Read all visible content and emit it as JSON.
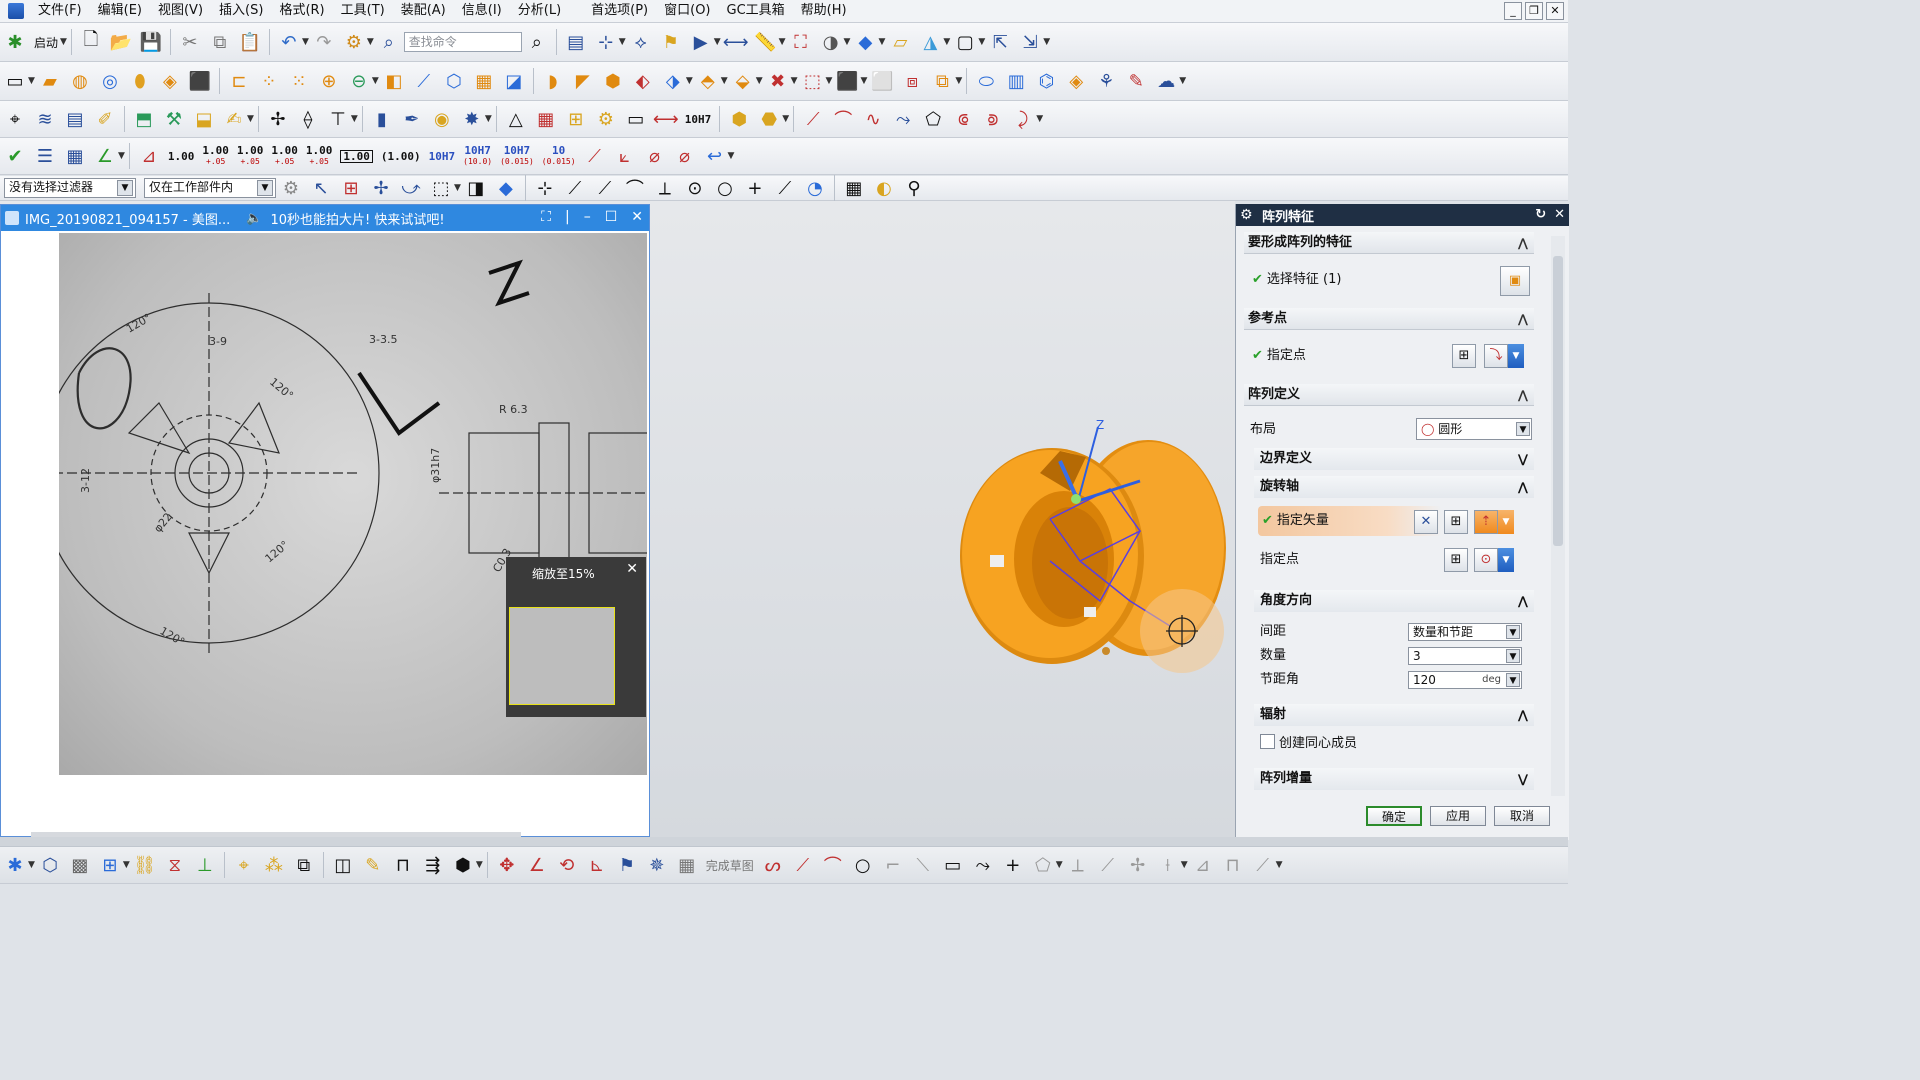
{
  "menu": {
    "items": [
      "文件(F)",
      "编辑(E)",
      "视图(V)",
      "插入(S)",
      "格式(R)",
      "工具(T)",
      "装配(A)",
      "信息(I)",
      "分析(L)",
      "首选项(P)",
      "窗口(O)",
      "GC工具箱",
      "帮助(H)"
    ]
  },
  "toolbar1": {
    "start_label": "启动",
    "search_placeholder": "查找命令"
  },
  "toolbar4": {
    "dims": [
      "1.00",
      "1.00",
      "1.00",
      "1.00",
      "1.00",
      "1.00",
      "(1.00)",
      "10H7",
      "10H7",
      "10H7",
      "10"
    ],
    "dim_subs": [
      "",
      "+.05",
      "+.05",
      "+.05",
      "+.05",
      "",
      "",
      "",
      "(10.0)",
      "(0.015)",
      "(0.015)"
    ]
  },
  "filterbar": {
    "filter_label": "没有选择过滤器",
    "scope_label": "仅在工作部件内"
  },
  "viewer": {
    "title": "IMG_20190821_094157 - 美图...",
    "ad_text": "10秒也能拍大片! 快来试试吧!",
    "zoom_label": "缩放至15%"
  },
  "dialog": {
    "title": "阵列特征",
    "sec_features": "要形成阵列的特征",
    "select_feature": "选择特征 (1)",
    "sec_ref_point": "参考点",
    "specify_point": "指定点",
    "sec_array_def": "阵列定义",
    "layout_label": "布局",
    "layout_value": "圆形",
    "sub_boundary": "边界定义",
    "sub_rotation": "旋转轴",
    "specify_vector": "指定矢量",
    "specify_point2": "指定点",
    "sub_angle": "角度方向",
    "spacing_label": "间距",
    "spacing_value": "数量和节距",
    "count_label": "数量",
    "count_value": "3",
    "pitch_label": "节距角",
    "pitch_value": "120",
    "pitch_unit": "deg",
    "sub_radiate": "辐射",
    "concentric_label": "创建同心成员",
    "sub_increment": "阵列增量",
    "ok": "确定",
    "apply": "应用",
    "cancel": "取消"
  },
  "bottombar": {
    "finish_sketch": "完成草图"
  },
  "colors": {
    "part_orange": "#f3a11c",
    "viewer_title": "#2f88e0",
    "dialog_title": "#1f2f44"
  }
}
